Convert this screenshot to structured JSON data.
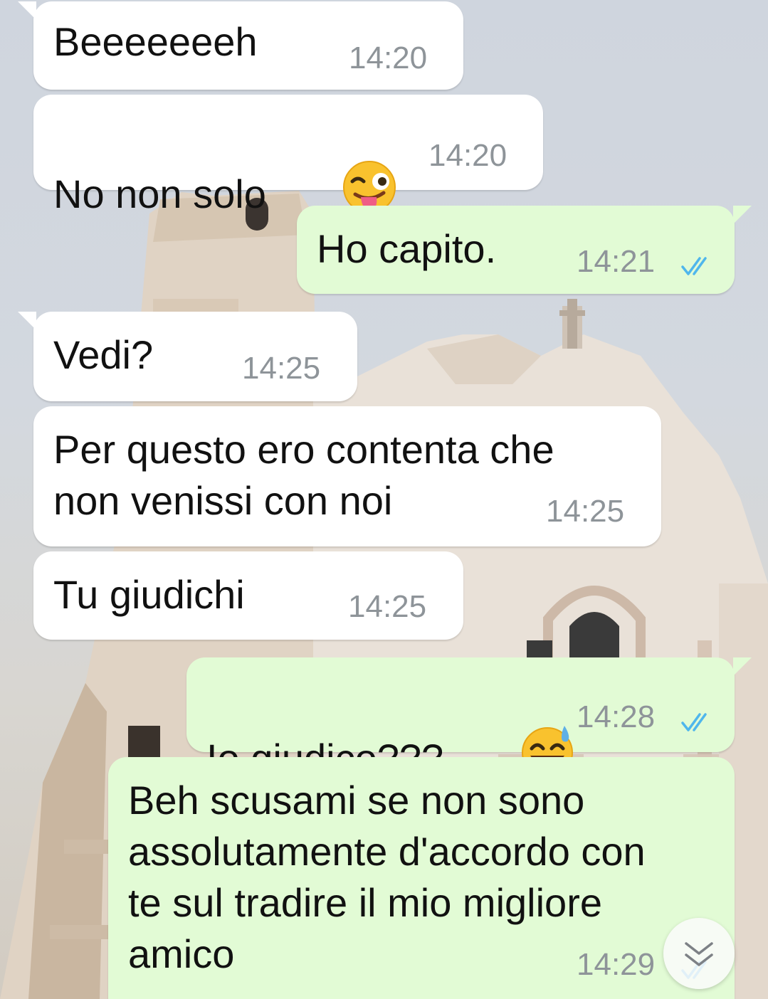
{
  "chat": {
    "messages": [
      {
        "direction": "incoming",
        "text": "Beeeeeeeh",
        "time": "14:20"
      },
      {
        "direction": "incoming",
        "text": "No non solo",
        "emoji": "winking-face-with-tongue",
        "time": "14:20"
      },
      {
        "direction": "outgoing",
        "text": "Ho capito.",
        "time": "14:21",
        "status": "read"
      },
      {
        "direction": "incoming",
        "text": "Vedi?",
        "time": "14:25"
      },
      {
        "direction": "incoming",
        "lines": [
          "Per questo ero contenta che",
          "non venissi con noi"
        ],
        "time": "14:25"
      },
      {
        "direction": "incoming",
        "text": "Tu giudichi",
        "time": "14:25"
      },
      {
        "direction": "outgoing",
        "text": "Io giudico???",
        "emoji": "grinning-face-with-sweat",
        "time": "14:28",
        "status": "read"
      },
      {
        "direction": "outgoing",
        "lines": [
          "Beh scusami se non sono",
          "assolutamente d'accordo con",
          "te sul tradire il mio migliore",
          "amico"
        ],
        "time": "14:29",
        "status": "read"
      }
    ]
  },
  "colors": {
    "incoming_bubble": "#ffffff",
    "outgoing_bubble": "#e2fbd5",
    "timestamp": "#8e9499",
    "read_ticks": "#4fb6ec"
  },
  "controls": {
    "scroll_to_bottom_icon": "double-chevron-down-icon"
  },
  "wallpaper": {
    "subject": "church-facade-photo"
  }
}
